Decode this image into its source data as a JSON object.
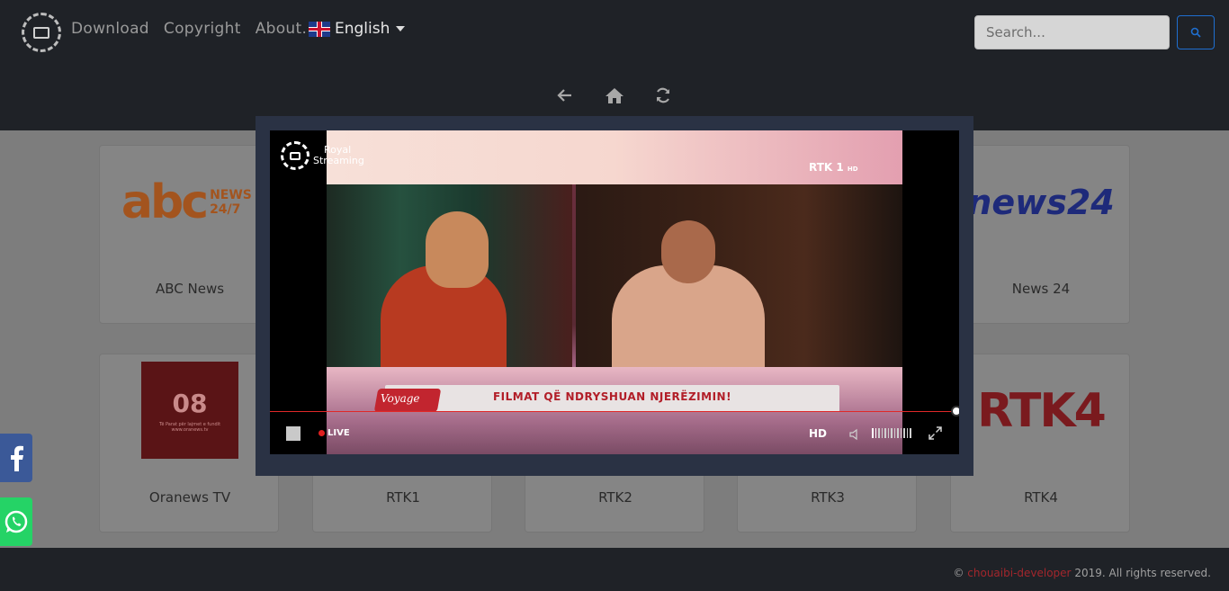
{
  "nav": {
    "links": [
      "Download",
      "Copyright",
      "About..."
    ],
    "language": "English"
  },
  "search": {
    "placeholder": "Search...",
    "button_icon": "search-icon"
  },
  "toolbar": {
    "icons": [
      "arrow-left-icon",
      "home-icon",
      "refresh-icon"
    ]
  },
  "channels": [
    {
      "name": "ABC News"
    },
    {
      "name": "News 24"
    },
    {
      "name": "Oranews TV"
    },
    {
      "name": "RTK1"
    },
    {
      "name": "RTK2"
    },
    {
      "name": "RTK3"
    },
    {
      "name": "RTK4"
    }
  ],
  "player": {
    "watermark_line1": "Royal",
    "watermark_line2": "Streaming",
    "channel_logo": "RTK 1",
    "channel_logo_sub": "HD",
    "ticker_tag": "Voyage",
    "ticker_text": "FILMAT QË NDRYSHUAN NJERËZIMIN!",
    "live_label": "LIVE",
    "quality_label": "HD",
    "volume_level": 0.15
  },
  "footer": {
    "prefix": "©",
    "author": "chouaibi-developer",
    "suffix": "2019. All rights reserved."
  },
  "thumbs": {
    "abc": "abc",
    "abc_side": "NEWS 24/7",
    "news24": "news24",
    "oranews": "08",
    "oranews_sub": "Të Parat për lajmet e fundit",
    "oranews_url": "www.oranews.tv",
    "rtk4": "RTK4"
  },
  "colors": {
    "header_bg": "#1f2227",
    "modal_frame": "#2a3244",
    "accent_red": "#e02828",
    "facebook": "#3b5998",
    "whatsapp": "#25d366",
    "search_btn": "#1f6fd0"
  }
}
